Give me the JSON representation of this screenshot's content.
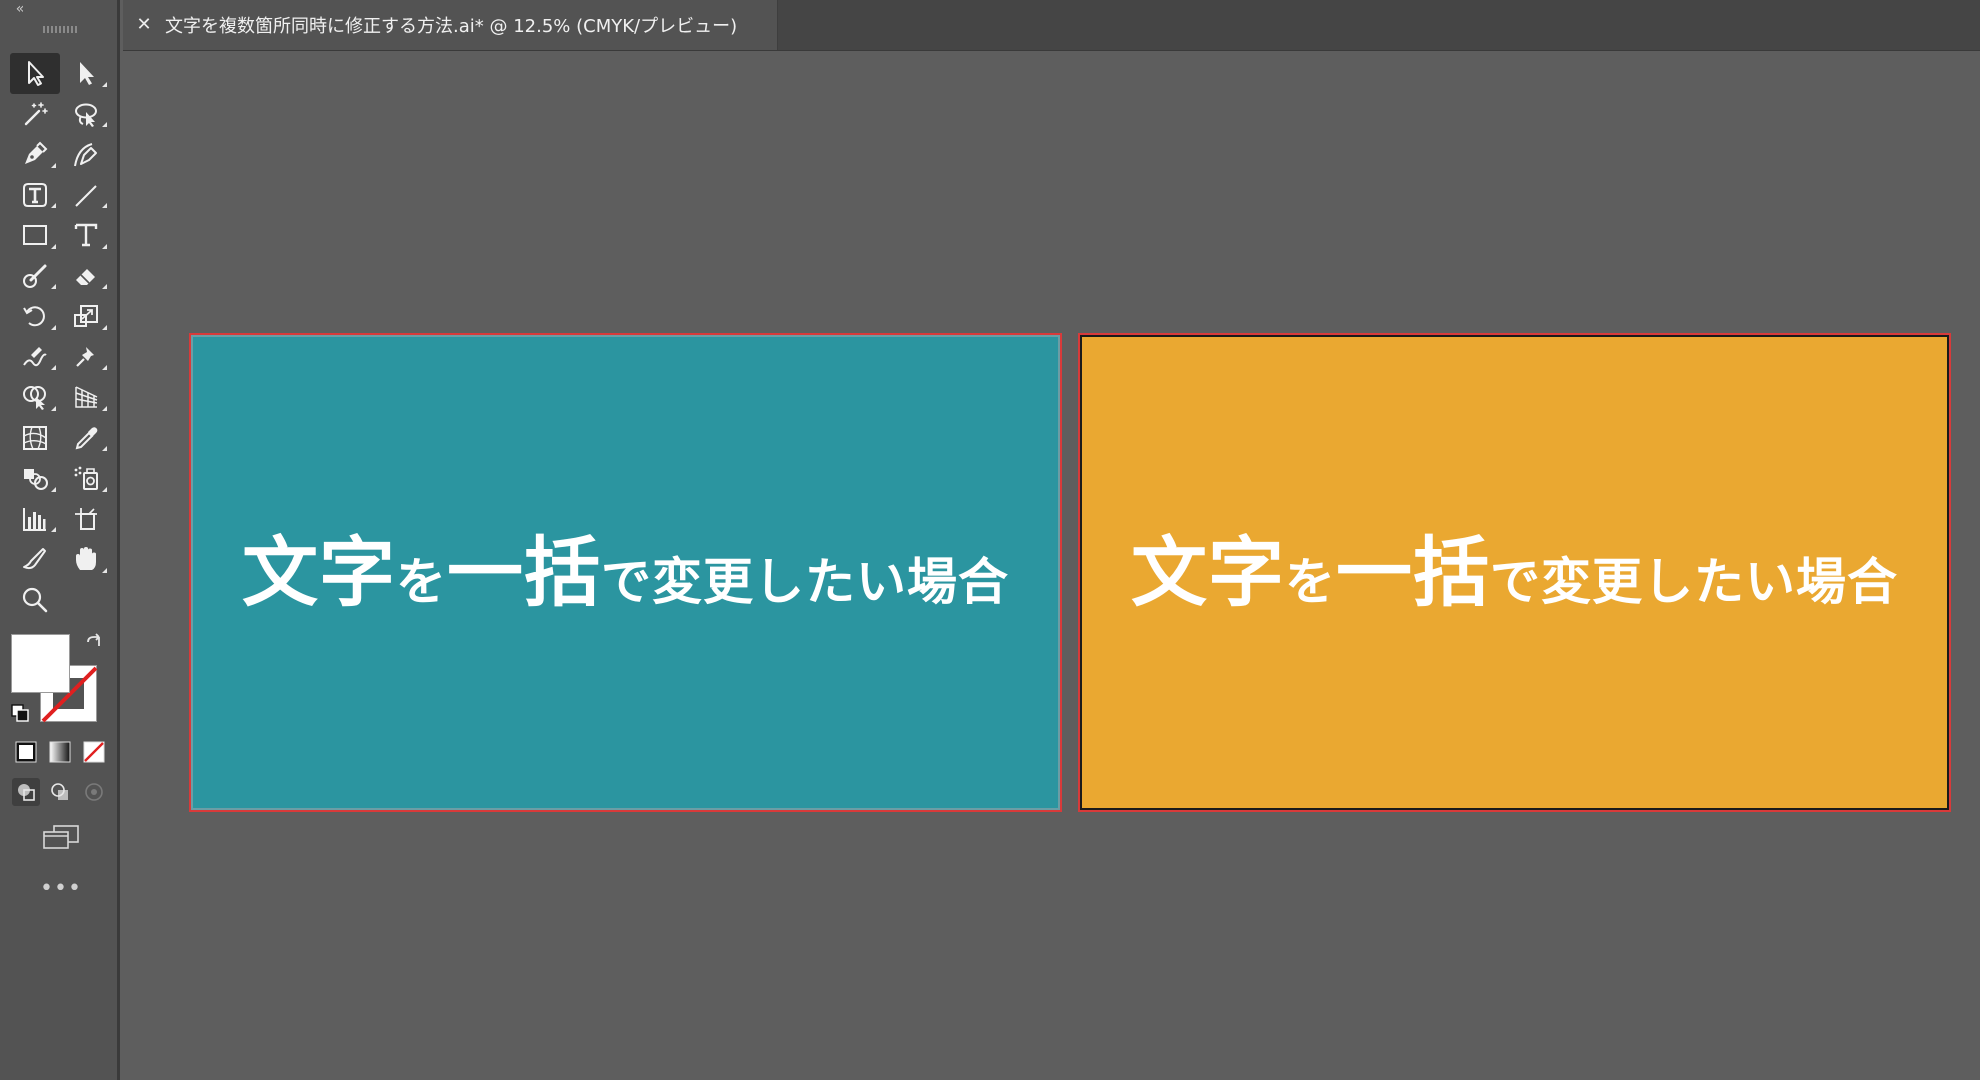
{
  "app": {
    "collapse_glyph": "«",
    "more_glyph": "•••"
  },
  "document_tab": {
    "close_glyph": "✕",
    "title": "文字を複数箇所同時に修正する方法.ai* @ 12.5% (CMYK/プレビュー)"
  },
  "tools": [
    {
      "name": "selection-tool",
      "icon": "selection-arrow-icon",
      "active": true
    },
    {
      "name": "direct-selection-tool",
      "icon": "direct-selection-arrow-icon",
      "active": false
    },
    {
      "name": "magic-wand-tool",
      "icon": "magic-wand-icon",
      "active": false
    },
    {
      "name": "lasso-tool",
      "icon": "lasso-icon",
      "active": false
    },
    {
      "name": "pen-tool",
      "icon": "pen-icon",
      "active": false
    },
    {
      "name": "curvature-tool",
      "icon": "curvature-icon",
      "active": false
    },
    {
      "name": "area-type-tool",
      "icon": "area-type-icon",
      "active": false
    },
    {
      "name": "line-segment-tool",
      "icon": "line-segment-icon",
      "active": false
    },
    {
      "name": "rectangle-tool",
      "icon": "rectangle-icon",
      "active": false
    },
    {
      "name": "type-tool",
      "icon": "type-icon",
      "active": false
    },
    {
      "name": "paintbrush-tool",
      "icon": "paintbrush-icon",
      "active": false
    },
    {
      "name": "eraser-tool",
      "icon": "eraser-icon",
      "active": false
    },
    {
      "name": "rotate-tool",
      "icon": "rotate-icon",
      "active": false
    },
    {
      "name": "scale-tool",
      "icon": "scale-icon",
      "active": false
    },
    {
      "name": "warp-tool",
      "icon": "warp-icon",
      "active": false
    },
    {
      "name": "puppet-warp-tool",
      "icon": "pushpin-icon",
      "active": false
    },
    {
      "name": "shape-builder-tool",
      "icon": "shape-builder-icon",
      "active": false
    },
    {
      "name": "perspective-grid-tool",
      "icon": "perspective-grid-icon",
      "active": false
    },
    {
      "name": "mesh-tool",
      "icon": "mesh-icon",
      "active": false
    },
    {
      "name": "eyedropper-tool",
      "icon": "eyedropper-icon",
      "active": false
    },
    {
      "name": "blend-tool",
      "icon": "blend-icon",
      "active": false
    },
    {
      "name": "symbol-sprayer-tool",
      "icon": "symbol-sprayer-icon",
      "active": false
    },
    {
      "name": "column-graph-tool",
      "icon": "column-graph-icon",
      "active": false
    },
    {
      "name": "artboard-tool",
      "icon": "artboard-icon",
      "active": false
    },
    {
      "name": "slice-tool",
      "icon": "slice-icon",
      "active": false
    },
    {
      "name": "hand-tool",
      "icon": "hand-icon",
      "active": false
    },
    {
      "name": "zoom-tool",
      "icon": "zoom-icon",
      "active": false
    }
  ],
  "swatches": {
    "fill_color": "#ffffff",
    "stroke_color": "none"
  },
  "artboards": [
    {
      "background": "#2b95a0",
      "text_parts": [
        {
          "text": "文字",
          "size": "big"
        },
        {
          "text": "を",
          "size": "small"
        },
        {
          "text": "一括",
          "size": "big"
        },
        {
          "text": "で変更したい場合",
          "size": "small"
        }
      ]
    },
    {
      "background": "#eaa831",
      "text_parts": [
        {
          "text": "文字",
          "size": "big"
        },
        {
          "text": "を",
          "size": "small"
        },
        {
          "text": "一括",
          "size": "big"
        },
        {
          "text": "で変更したい場合",
          "size": "small"
        }
      ]
    }
  ],
  "colors": {
    "panel_bg": "#535353",
    "canvas_bg": "#5e5e5e",
    "artboard_selection": "#d83a3a"
  }
}
